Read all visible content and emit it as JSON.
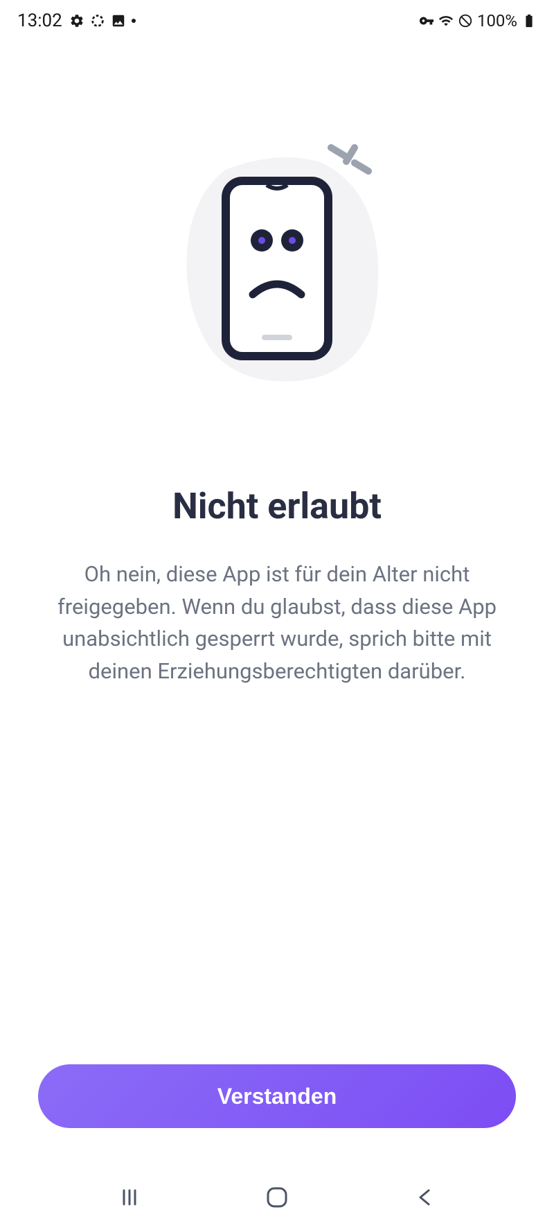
{
  "status_bar": {
    "time": "13:02",
    "battery_text": "100%"
  },
  "page": {
    "title": "Nicht erlaubt",
    "description": "Oh nein, diese App ist für dein Alter nicht freigegeben. Wenn du glaubst, dass diese App unabsichtlich gesperrt wurde, sprich bitte mit deinen Erziehungsberechtigten darüber.",
    "action_label": "Verstanden"
  }
}
